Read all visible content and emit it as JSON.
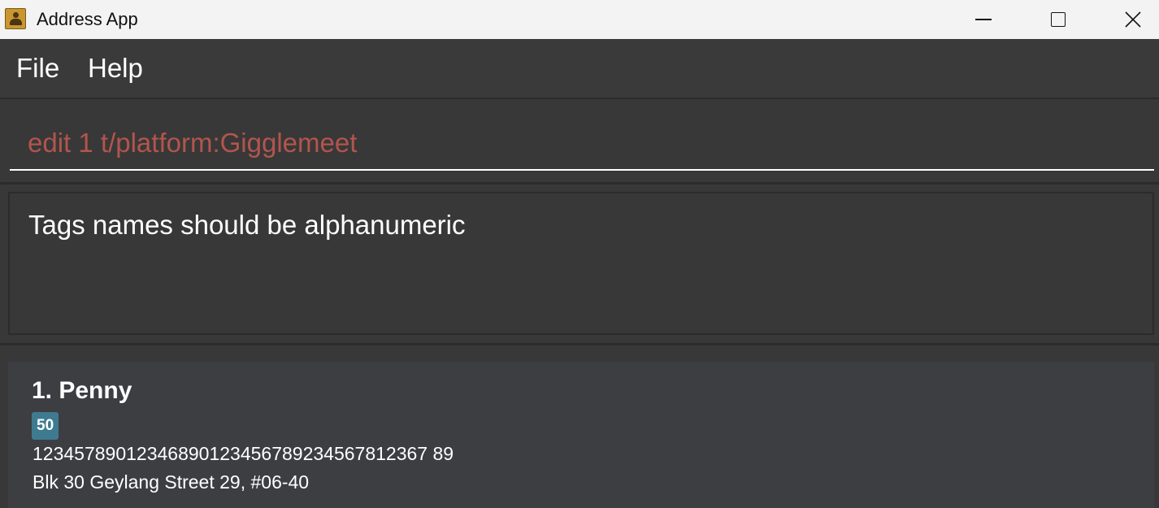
{
  "window": {
    "title": "Address App",
    "app_icon": "address-book-icon",
    "controls": [
      "minimize-icon",
      "maximize-icon",
      "close-icon"
    ],
    "close_glyph": "✕"
  },
  "menu": {
    "items": [
      {
        "label": "File"
      },
      {
        "label": "Help"
      }
    ]
  },
  "command": {
    "value": "edit 1 t/platform:Gigglemeet",
    "text_color": "#b2554d"
  },
  "result": {
    "message": "Tags names should be alphanumeric"
  },
  "persons": [
    {
      "name": "1. Penny",
      "tags": [
        "50"
      ],
      "phone": "12345789012346890123456789234567812367 89",
      "address": "Blk 30 Geylang Street 29, #06-40"
    }
  ],
  "colors": {
    "background": "#383838",
    "card": "#3c3e42",
    "tag": "#3e7b91",
    "titlebar": "#f3f3f3"
  }
}
